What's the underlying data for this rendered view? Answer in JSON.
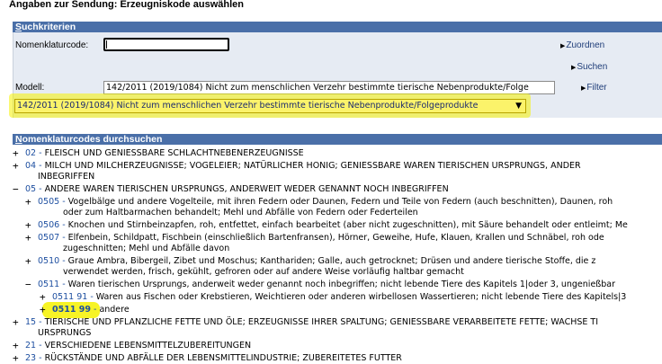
{
  "window_title": "Angaben zur Sendung: Erzeugniskode auswählen",
  "search": {
    "header_first": "S",
    "header_rest": "uchkriterien",
    "code_label": "Nomenklaturcode:",
    "code_value": "",
    "model_label": "Modell:",
    "model_input_value": "142/2011 (2019/1084) Nicht zum menschlichen Verzehr bestimmte tierische Nebenprodukte/Folge",
    "model_select_value": "142/2011 (2019/1084) Nicht zum menschlichen Verzehr bestimmte tierische Nebenprodukte/Folgeprodukte",
    "links": {
      "assign": "Zuordnen",
      "search": "Suchen",
      "filter": "Filter"
    }
  },
  "browse": {
    "header_first": "N",
    "header_rest": "omenklaturcodes durchsuchen",
    "rows": [
      {
        "toggle": "+",
        "code": "02",
        "text": "FLEISCH UND GENIESSBARE SCHLACHTNEBENERZEUGNISSE"
      },
      {
        "toggle": "+",
        "code": "04",
        "text": "MILCH UND MILCHERZEUGNISSE; VOGELEIER; NATÜRLICHER HONIG; GENIESSBARE WAREN TIERISCHEN URSPRUNGS, ANDER"
      },
      {
        "toggle": "",
        "code": "",
        "text": "INBEGRIFFEN"
      },
      {
        "toggle": "−",
        "code": "05",
        "text": "ANDERE WAREN TIERISCHEN URSPRUNGS, ANDERWEIT WEDER GENANNT NOCH INBEGRIFFEN"
      },
      {
        "toggle": "+",
        "code": "0505",
        "text": "Vogelbälge und andere Vogelteile, mit ihren Federn oder Daunen, Federn und Teile von Federn (auch beschnitten), Daunen, roh"
      },
      {
        "toggle": "",
        "code": "",
        "text": "oder zum Haltbarmachen behandelt; Mehl und Abfälle von Federn oder Federteilen"
      },
      {
        "toggle": "+",
        "code": "0506",
        "text": "Knochen und Stirnbeinzapfen, roh, entfettet, einfach bearbeitet (aber nicht zugeschnitten), mit Säure behandelt oder entleimt; Me"
      },
      {
        "toggle": "+",
        "code": "0507",
        "text": "Elfenbein, Schildpatt, Fischbein (einschließlich Bartenfransen), Hörner, Geweihe, Hufe, Klauen, Krallen und Schnäbel, roh ode"
      },
      {
        "toggle": "",
        "code": "",
        "text": "zugeschnitten; Mehl und Abfälle davon"
      },
      {
        "toggle": "+",
        "code": "0510",
        "text": "Graue Ambra, Bibergeil, Zibet und Moschus; Kanthariden; Galle, auch getrocknet; Drüsen und andere tierische Stoffe, die z"
      },
      {
        "toggle": "",
        "code": "",
        "text": "verwendet werden, frisch, gekühlt, gefroren oder auf andere Weise vorläufig haltbar gemacht"
      },
      {
        "toggle": "−",
        "code": "0511",
        "text": "Waren tierischen Ursprungs, anderweit weder genannt noch inbegriffen; nicht lebende Tiere des Kapitels 1|oder 3, ungenießbar"
      },
      {
        "toggle": "+",
        "code": "0511 91",
        "text": "Waren aus Fischen oder Krebstieren, Weichtieren oder anderen wirbellosen Wassertieren; nicht lebende Tiere des Kapitels|3"
      },
      {
        "toggle": "+",
        "code": "0511 99",
        "text": "andere"
      },
      {
        "toggle": "+",
        "code": "15",
        "text": "TIERISCHE UND PFLANZLICHE FETTE UND ÖLE; ERZEUGNISSE IHRER SPALTUNG; GENIESSBARE VERARBEITETE FETTE; WACHSE TI"
      },
      {
        "toggle": "",
        "code": "",
        "text": "URSPRUNGS"
      },
      {
        "toggle": "+",
        "code": "21",
        "text": "VERSCHIEDENE LEBENSMITTELZUBEREITUNGEN"
      },
      {
        "toggle": "+",
        "code": "23",
        "text": "RÜCKSTÄNDE UND ABFÄLLE DER LEBENSMITTELINDUSTRIE; ZUBEREITETES FUTTER"
      }
    ]
  },
  "colors": {
    "header": "#4a6fa8",
    "panel": "#e6ebf3",
    "highlight": "#f6f200",
    "code_link": "#1e4fa0"
  }
}
